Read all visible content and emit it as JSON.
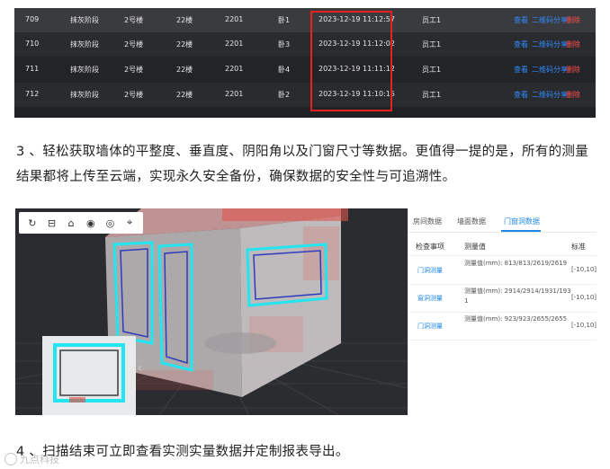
{
  "records_table": {
    "rows": [
      {
        "id": "709",
        "stage": "抹灰阶段",
        "building": "2号楼",
        "floor": "22楼",
        "room": "2201",
        "type": "卧1",
        "time": "2023-12-19 11:12:57",
        "user": "员工1",
        "view": "查看",
        "share": "二维码分享",
        "delete": "删除"
      },
      {
        "id": "710",
        "stage": "抹灰阶段",
        "building": "2号楼",
        "floor": "22楼",
        "room": "2201",
        "type": "卧3",
        "time": "2023-12-19 11:12:02",
        "user": "员工1",
        "view": "查看",
        "share": "二维码分享",
        "delete": "删除"
      },
      {
        "id": "711",
        "stage": "抹灰阶段",
        "building": "2号楼",
        "floor": "22楼",
        "room": "2201",
        "type": "卧4",
        "time": "2023-12-19 11:11:12",
        "user": "员工1",
        "view": "查看",
        "share": "二维码分享",
        "delete": "删除"
      },
      {
        "id": "712",
        "stage": "抹灰阶段",
        "building": "2号楼",
        "floor": "22楼",
        "room": "2201",
        "type": "卧2",
        "time": "2023-12-19 11:10:15",
        "user": "员工1",
        "view": "查看",
        "share": "二维码分享",
        "delete": "删除"
      }
    ]
  },
  "paragraph_3": "3 、轻松获取墙体的平整度、垂直度、阴阳角以及门窗尺寸等数据。更值得一提的是，所有的测量结果都将上传至云端，实现永久安全备份，确保数据的安全性与可追溯性。",
  "paragraph_4": "4 、扫描结束可立即查看实测实量数据并定制报表导出。",
  "viewer": {
    "toolbar_icons": [
      "refresh-icon",
      "minus-box-icon",
      "home-icon",
      "eye-icon",
      "target-icon",
      "crosshair-icon"
    ]
  },
  "panel": {
    "tabs": [
      {
        "label": "房间数据",
        "active": false
      },
      {
        "label": "墙面数据",
        "active": false
      },
      {
        "label": "门窗洞数据",
        "active": true
      }
    ],
    "headers": {
      "item": "检查事项",
      "value": "测量值",
      "standard": "标准"
    },
    "rows": [
      {
        "item": "门洞测量",
        "value": "测量值(mm): 813/813/2619/2619",
        "standard": "[-10,10]"
      },
      {
        "item": "窗洞测量",
        "value": "测量值(mm): 2914/2914/1931/1931",
        "standard": "[-10,10]"
      },
      {
        "item": "门洞测量",
        "value": "测量值(mm): 923/923/2655/2655",
        "standard": "[-10,10]"
      }
    ]
  },
  "watermark": "九点科技",
  "colors": {
    "accent": "#1e88e5",
    "delete": "#ff4d4f",
    "highlight": "#e82020",
    "scan_cyan": "#21e6f0"
  }
}
